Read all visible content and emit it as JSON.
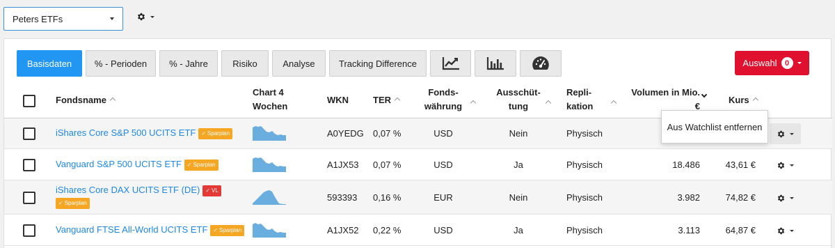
{
  "topbar": {
    "list_name": "Peters ETFs"
  },
  "tabs": [
    {
      "label": "Basisdaten",
      "active": true
    },
    {
      "label": "% - Perioden"
    },
    {
      "label": "% - Jahre"
    },
    {
      "label": "Risiko"
    },
    {
      "label": "Analyse"
    },
    {
      "label": "Tracking Difference"
    },
    {
      "icon": "line-chart-icon"
    },
    {
      "icon": "bar-chart-icon"
    },
    {
      "icon": "speedometer-icon"
    }
  ],
  "auswahl": {
    "label": "Auswahl",
    "count": "0"
  },
  "columns": {
    "fondsname": "Fondsname",
    "chart_line1": "Chart 4",
    "chart_line2": "Wochen",
    "wkn": "WKN",
    "ter": "TER",
    "waehrung_line1": "Fonds-",
    "waehrung_line2": "währung",
    "ausschuettung_line1": "Ausschüt-",
    "ausschuettung_line2": "tung",
    "replikation_line1": "Repli-",
    "replikation_line2": "kation",
    "volumen_line1": "Volumen in Mio.",
    "volumen_line2": "€",
    "kurs": "Kurs"
  },
  "badges": {
    "sparplan": "Sparplan",
    "vl": "VL"
  },
  "rows": [
    {
      "name": "iShares Core S&P 500 UCITS ETF",
      "wkn": "A0YEDG",
      "ter": "0,07 %",
      "currency": "USD",
      "distribution": "Nein",
      "replication": "Physisch",
      "volume": "",
      "price": ""
    },
    {
      "name": "Vanguard S&P 500 UCITS ETF",
      "wkn": "A1JX53",
      "ter": "0,07 %",
      "currency": "USD",
      "distribution": "Ja",
      "replication": "Physisch",
      "volume": "18.486",
      "price": "43,61 €"
    },
    {
      "name": "iShares Core DAX UCITS ETF (DE)",
      "wkn": "593393",
      "ter": "0,16 %",
      "currency": "EUR",
      "distribution": "Nein",
      "replication": "Physisch",
      "volume": "3.982",
      "price": "74,82 €"
    },
    {
      "name": "Vanguard FTSE All-World UCITS ETF",
      "wkn": "A1JX52",
      "ter": "0,22 %",
      "currency": "USD",
      "distribution": "Ja",
      "replication": "Physisch",
      "volume": "3.113",
      "price": "64,87 €"
    }
  ],
  "popup": {
    "label": "Aus Watchlist entfernen"
  },
  "colors": {
    "accent": "#2196f3",
    "auswahl": "#e0112f",
    "sparplan": "#f5a623",
    "vl": "#e53935",
    "link": "#1e88e5",
    "sparkline": "#6aaee0"
  }
}
